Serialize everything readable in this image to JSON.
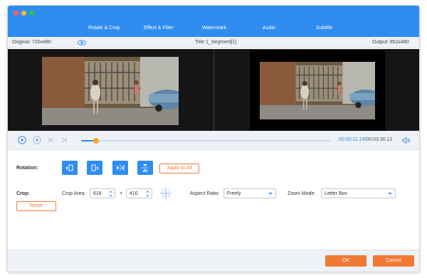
{
  "tabs": [
    "Rotate & Crop",
    "Effect & Filter",
    "Watermark",
    "Audio",
    "Subtitle"
  ],
  "info": {
    "original": "Original: 720x480",
    "title": "Title 1_Segment[1]",
    "output": "Output: 852x480"
  },
  "playback": {
    "current_time": "00:00:11.18",
    "separator": "/",
    "duration": "00:03:30.12",
    "progress": 0.06
  },
  "rotation": {
    "label": "Rotation:",
    "apply_to_all": "Apply to All"
  },
  "crop": {
    "label": "Crop:",
    "area_label": "Crop Area:",
    "width": "616",
    "times": "×",
    "height": "410",
    "aspect_label": "Aspect Ratio:",
    "aspect_value": "Freely",
    "zoom_label": "Zoom Mode:",
    "zoom_value": "Letter Box",
    "reset": "Reset"
  },
  "footer": {
    "ok": "OK",
    "cancel": "Cancel"
  },
  "colors": {
    "accent": "#2f8df0",
    "action": "#f07a35",
    "thumb": "#f5a623"
  },
  "icons": [
    "close-dot",
    "minimize-dot",
    "maximize-dot",
    "eye-icon",
    "play-icon",
    "stop-icon",
    "previous-frame-icon",
    "next-frame-icon",
    "volume-icon",
    "rotate-left-icon",
    "rotate-right-icon",
    "flip-horizontal-icon",
    "flip-vertical-icon",
    "crop-center-icon",
    "chevron-down-icon"
  ]
}
